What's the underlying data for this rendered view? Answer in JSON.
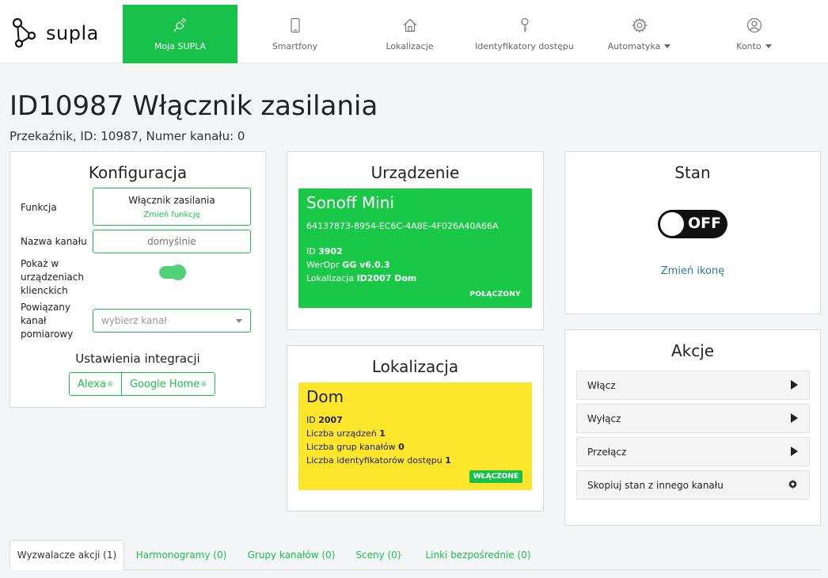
{
  "nav": {
    "brand": "supla",
    "items": [
      {
        "label": "Moja SUPLA",
        "icon": "plug-icon",
        "active": true
      },
      {
        "label": "Smartfony",
        "icon": "smartphone-icon"
      },
      {
        "label": "Lokalizacje",
        "icon": "home-icon"
      },
      {
        "label": "Identyfikatory dostępu",
        "icon": "key-icon"
      },
      {
        "label": "Automatyka",
        "icon": "gear-icon",
        "dropdown": true
      },
      {
        "label": "Konto",
        "icon": "user-icon",
        "dropdown": true
      }
    ]
  },
  "page": {
    "title": "ID10987 Włącznik zasilania",
    "subtitle": "Przekaźnik, ID: 10987, Numer kanału: 0"
  },
  "config": {
    "title": "Konfiguracja",
    "function_label": "Funkcja",
    "function_value": "Włącznik zasilania",
    "function_change": "Zmień funkcję",
    "name_label": "Nazwa kanału",
    "name_placeholder": "domyślnie",
    "show_label_1": "Pokaż w",
    "show_label_2": "urządzeniach",
    "show_label_3": "klienckich",
    "show_enabled": true,
    "related_label_1": "Powiązany",
    "related_label_2": "kanał",
    "related_label_3": "pomiarowy",
    "related_placeholder": "wybierz kanał",
    "integrations_title": "Ustawienia integracji",
    "integrations": [
      "Alexa",
      "Google Home"
    ],
    "reg_mark": "®"
  },
  "device": {
    "title": "Urządzenie",
    "name": "Sonoff Mini",
    "guid": "64137873-8954-EC6C-4A8E-4F026A40A66A",
    "id_label": "ID",
    "id_value": "3902",
    "soft_label": "WerOpr",
    "soft_value": "GG v6.0.3",
    "location_label": "Lokalizacja",
    "location_value": "ID2007 Dom",
    "status": "POŁĄCZONY"
  },
  "location": {
    "title": "Lokalizacja",
    "name": "Dom",
    "id_label": "ID",
    "id_value": "2007",
    "devices_label": "Liczba urządzeń",
    "devices_value": "1",
    "groups_label": "Liczba grup kanałów",
    "groups_value": "0",
    "aids_label": "Liczba identyfikatorów dostępu",
    "aids_value": "1",
    "status": "WŁĄCZONE"
  },
  "state": {
    "title": "Stan",
    "switch_text": "OFF",
    "change_icon": "Zmień ikonę"
  },
  "actions": {
    "title": "Akcje",
    "items": [
      {
        "label": "Włącz",
        "icon": "play-icon"
      },
      {
        "label": "Wyłącz",
        "icon": "play-icon"
      },
      {
        "label": "Przełącz",
        "icon": "play-icon"
      },
      {
        "label": "Skopiuj stan z innego kanału",
        "icon": "gear-icon"
      }
    ]
  },
  "tabs": [
    {
      "label": "Wyzwalacze akcji (1)",
      "active": true
    },
    {
      "label": "Harmonogramy (0)"
    },
    {
      "label": "Grupy kanałów (0)"
    },
    {
      "label": "Sceny (0)"
    },
    {
      "label": "Linki bezpośrednie (0)"
    }
  ],
  "colors": {
    "accent": "#18c24a",
    "device_card": "#1ac848",
    "location_card": "#fde52c",
    "link": "#2c7a9a"
  }
}
